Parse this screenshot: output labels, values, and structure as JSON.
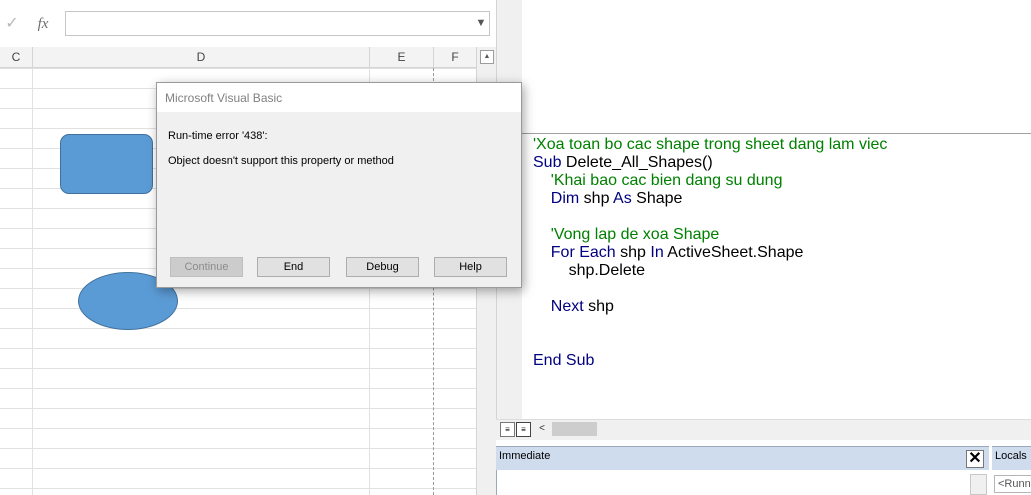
{
  "excel": {
    "formula_bar": {
      "check_icon": "✓",
      "fx_icon": "fx",
      "value": "",
      "dropdown_icon": "chevron-down"
    },
    "columns": [
      "C",
      "D",
      "E",
      "F"
    ],
    "shapes": [
      "rounded-rectangle",
      "ellipse"
    ],
    "shape_color": "#5b9bd5"
  },
  "dialog": {
    "title": "Microsoft Visual Basic",
    "error": "Run-time error '438':",
    "message": "Object doesn't support this property or method",
    "buttons": {
      "continue": "Continue",
      "end": "End",
      "debug": "Debug",
      "help": "Help"
    }
  },
  "code": {
    "lines": [
      {
        "parts": [
          {
            "t": "'Xoa toan bo cac shape trong sheet dang lam viec",
            "c": "cm"
          }
        ]
      },
      {
        "parts": [
          {
            "t": "Sub",
            "c": "kw"
          },
          {
            "t": " Delete_All_Shapes()",
            "c": "tx"
          }
        ]
      },
      {
        "parts": [
          {
            "t": "    'Khai bao cac bien dang su dung",
            "c": "cm"
          }
        ]
      },
      {
        "parts": [
          {
            "t": "    ",
            "c": "tx"
          },
          {
            "t": "Dim",
            "c": "kw"
          },
          {
            "t": " shp ",
            "c": "tx"
          },
          {
            "t": "As",
            "c": "kw"
          },
          {
            "t": " Shape",
            "c": "tx"
          }
        ]
      },
      {
        "parts": [
          {
            "t": "",
            "c": "tx"
          }
        ]
      },
      {
        "parts": [
          {
            "t": "    'Vong lap de xoa Shape",
            "c": "cm"
          }
        ]
      },
      {
        "parts": [
          {
            "t": "    ",
            "c": "tx"
          },
          {
            "t": "For Each",
            "c": "kw"
          },
          {
            "t": " shp ",
            "c": "tx"
          },
          {
            "t": "In",
            "c": "kw"
          },
          {
            "t": " ActiveSheet.Shape",
            "c": "tx"
          }
        ]
      },
      {
        "parts": [
          {
            "t": "        shp.Delete",
            "c": "tx"
          }
        ]
      },
      {
        "parts": [
          {
            "t": "",
            "c": "tx"
          }
        ]
      },
      {
        "parts": [
          {
            "t": "    ",
            "c": "tx"
          },
          {
            "t": "Next",
            "c": "kw"
          },
          {
            "t": " shp",
            "c": "tx"
          }
        ]
      },
      {
        "parts": [
          {
            "t": "",
            "c": "tx"
          }
        ]
      },
      {
        "parts": [
          {
            "t": "",
            "c": "tx"
          }
        ]
      },
      {
        "parts": [
          {
            "t": "End Sub",
            "c": "kw"
          }
        ]
      }
    ],
    "colors": {
      "keyword": "#000080",
      "comment": "#008000",
      "text": "#000000"
    }
  },
  "immediate": {
    "title": "Immediate",
    "close_icon": "✕"
  },
  "locals": {
    "title": "Locals",
    "field_value": "<Runn"
  }
}
